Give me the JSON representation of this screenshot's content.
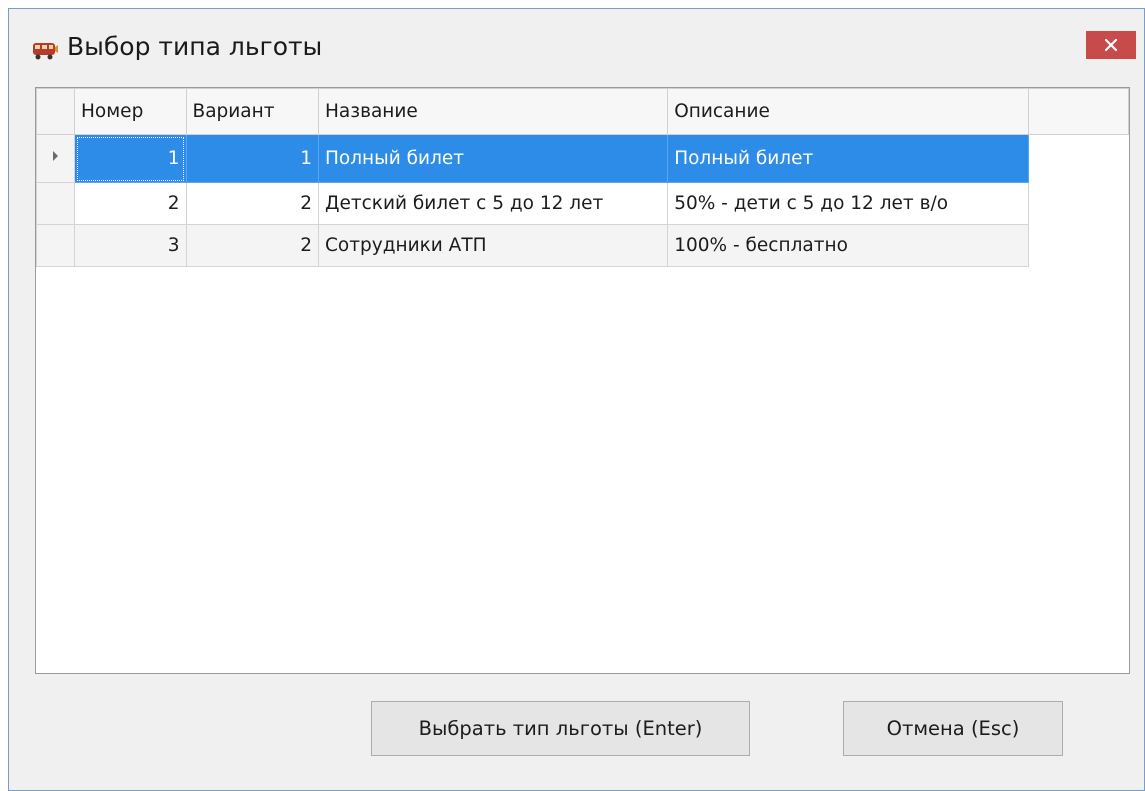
{
  "window": {
    "title": "Выбор типа льготы",
    "icon": "train-icon",
    "close_icon": "close-icon"
  },
  "grid": {
    "columns": [
      "Номер",
      "Вариант",
      "Название",
      "Описание"
    ],
    "rows": [
      {
        "number": "1",
        "variant": "1",
        "name": "Полный билет",
        "description": "Полный билет",
        "selected": true
      },
      {
        "number": "2",
        "variant": "2",
        "name": "Детский билет с 5 до 12 лет",
        "description": "50% -  дети с 5 до 12 лет в/о",
        "selected": false
      },
      {
        "number": "3",
        "variant": "2",
        "name": "Сотрудники АТП",
        "description": "100% - бесплатно",
        "selected": false
      }
    ]
  },
  "buttons": {
    "select_label": "Выбрать тип льготы (Enter)",
    "cancel_label": "Отмена (Esc)"
  },
  "colors": {
    "selection": "#2d8ce8",
    "close_button": "#c74b4b"
  }
}
